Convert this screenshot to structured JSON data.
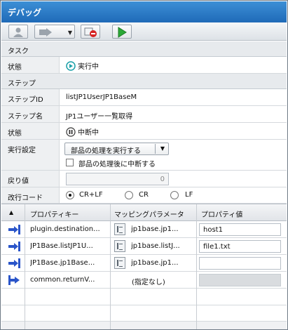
{
  "title": "デバッグ",
  "task_section": "タスク",
  "status_label": "状態",
  "task_status": "実行中",
  "step_section": "ステップ",
  "step_id_label": "ステップID",
  "step_id": "listJP1UserJP1BaseM",
  "step_name_label": "ステップ名",
  "step_name": "JP1ユーザー一覧取得",
  "step_status_label": "状態",
  "step_status": "中断中",
  "exec_setting_label": "実行設定",
  "exec_setting_value": "部品の処理を実行する",
  "interrupt_after_label": "部品の処理後に中断する",
  "return_label": "戻り値",
  "return_value": "0",
  "newline_label": "改行コード",
  "newline_options": [
    "CR+LF",
    "CR",
    "LF"
  ],
  "newline_selected": "CR+LF",
  "grid": {
    "sort_header": "▲",
    "columns": [
      "プロパティキー",
      "マッピングパラメータ",
      "プロパティ値"
    ],
    "rows": [
      {
        "key": "plugin.destination...",
        "mapping": "jp1base.jp1...",
        "value": "host1"
      },
      {
        "key": "JP1Base.listJP1U...",
        "mapping": "jp1base.listJ...",
        "value": "file1.txt"
      },
      {
        "key": "JP1Base.jp1Base...",
        "mapping": "jp1base.jp1...",
        "value": ""
      },
      {
        "key": "common.returnV...",
        "mapping": "(指定なし)",
        "value": ""
      }
    ]
  },
  "colors": {
    "title_bar": "#1f6ab8",
    "run_icon": "#1aa0a8",
    "play_green": "#2aa836",
    "stop_red": "#d62424",
    "in_arrow": "#2a55c9",
    "out_arrow": "#2a55c9"
  }
}
